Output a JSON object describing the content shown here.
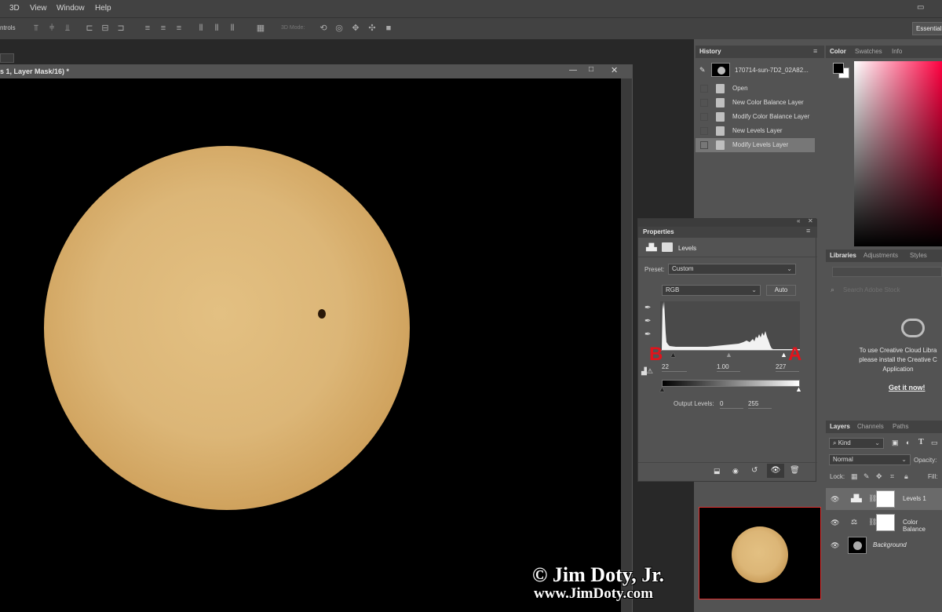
{
  "menu": {
    "items": [
      "3D",
      "View",
      "Window",
      "Help"
    ]
  },
  "options_bar": {
    "left_label": "ntrols",
    "mode_label": "3D Mode:",
    "workspace_button": "Essentials"
  },
  "document": {
    "tab_label": "s 1, Layer Mask/16) *"
  },
  "watermark": {
    "line1": "© Jim Doty, Jr.",
    "line2": "www.JimDoty.com"
  },
  "history": {
    "tab": "History",
    "snapshot": "170714-sun-7D2_02A82...",
    "items": [
      "Open",
      "New Color Balance Layer",
      "Modify Color Balance Layer",
      "New Levels Layer",
      "Modify Levels Layer"
    ],
    "selected_index": 4
  },
  "color_panel": {
    "tabs": [
      "Color",
      "Swatches",
      "Info"
    ]
  },
  "libraries": {
    "tabs": [
      "Libraries",
      "Adjustments",
      "Styles"
    ],
    "search_placeholder": "Search Adobe Stock",
    "message": "To use Creative Cloud Libra please install the Creative C Application",
    "link": "Get it now!"
  },
  "properties": {
    "tab": "Properties",
    "title": "Levels",
    "preset_label": "Preset:",
    "preset_value": "Custom",
    "channel_value": "RGB",
    "auto_label": "Auto",
    "input_black": "22",
    "input_gamma": "1.00",
    "input_white": "227",
    "output_label": "Output Levels:",
    "output_black": "0",
    "output_white": "255",
    "annotation_a": "A",
    "annotation_b": "B"
  },
  "layers": {
    "tabs": [
      "Layers",
      "Channels",
      "Paths"
    ],
    "kind_value": "Kind",
    "blend_value": "Normal",
    "opacity_label": "Opacity:",
    "lock_label": "Lock:",
    "fill_label": "Fill:",
    "items": [
      "Levels 1",
      "Color Balance",
      "Background"
    ]
  },
  "colors": {
    "accent_red": "#e0141c",
    "sun": "#dcb677",
    "panel_bg": "#535353"
  }
}
